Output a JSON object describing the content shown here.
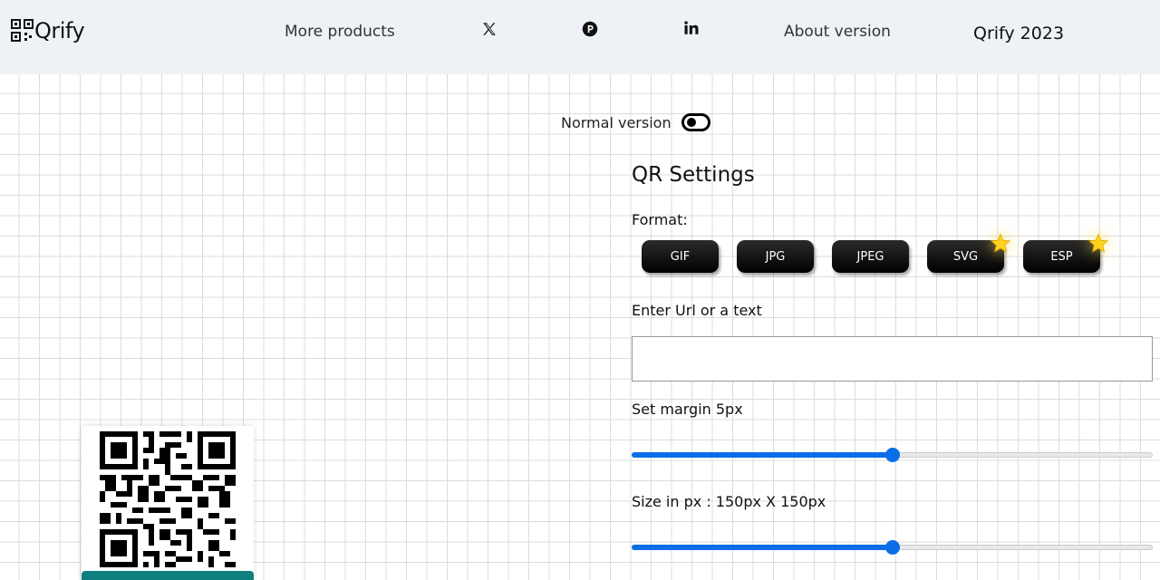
{
  "header": {
    "logo_text": "Qrify",
    "nav": {
      "more_products": "More products",
      "about_version": "About version",
      "brand_year": "Qrify 2023"
    },
    "icons": [
      "x-twitter-icon",
      "producthunt-icon",
      "linkedin-icon"
    ]
  },
  "mode_toggle": {
    "label": "Normal version"
  },
  "settings": {
    "title": "QR Settings",
    "format_label": "Format:",
    "formats": [
      {
        "label": "GIF",
        "premium": false
      },
      {
        "label": "JPG",
        "premium": false
      },
      {
        "label": "JPEG",
        "premium": false
      },
      {
        "label": "SVG",
        "premium": true
      },
      {
        "label": "ESP",
        "premium": true
      }
    ],
    "url_label": "Enter Url or a text",
    "url_value": "",
    "margin_label": "Set margin 5px",
    "margin_fraction": 0.5,
    "size_label": "Size in px : 150px X 150px",
    "size_fraction": 0.5
  },
  "colors": {
    "header_bg": "#eef1f6",
    "accent_blue": "#0a6ee8",
    "star_gold": "#ffd21f",
    "qr_bar_teal": "#0f7e7e"
  }
}
